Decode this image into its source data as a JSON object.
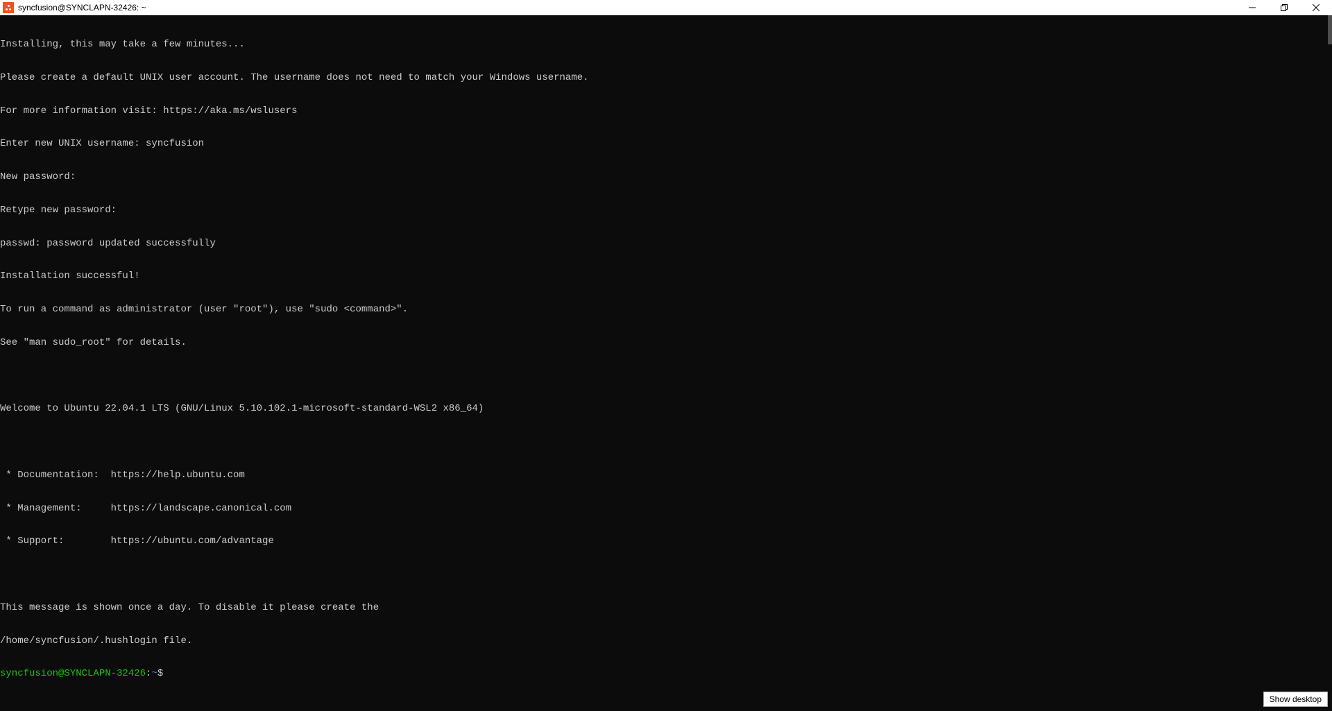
{
  "window": {
    "title": "syncfusion@SYNCLAPN-32426: ~"
  },
  "terminal": {
    "lines": [
      "Installing, this may take a few minutes...",
      "Please create a default UNIX user account. The username does not need to match your Windows username.",
      "For more information visit: https://aka.ms/wslusers",
      "Enter new UNIX username: syncfusion",
      "New password:",
      "Retype new password:",
      "passwd: password updated successfully",
      "Installation successful!",
      "To run a command as administrator (user \"root\"), use \"sudo <command>\".",
      "See \"man sudo_root\" for details.",
      "",
      "Welcome to Ubuntu 22.04.1 LTS (GNU/Linux 5.10.102.1-microsoft-standard-WSL2 x86_64)",
      "",
      " * Documentation:  https://help.ubuntu.com",
      " * Management:     https://landscape.canonical.com",
      " * Support:        https://ubuntu.com/advantage",
      "",
      "This message is shown once a day. To disable it please create the",
      "/home/syncfusion/.hushlogin file."
    ],
    "prompt": {
      "user_host": "syncfusion@SYNCLAPN-32426",
      "colon": ":",
      "path": "~",
      "dollar": "$"
    }
  },
  "tooltip": {
    "text": "Show desktop"
  }
}
